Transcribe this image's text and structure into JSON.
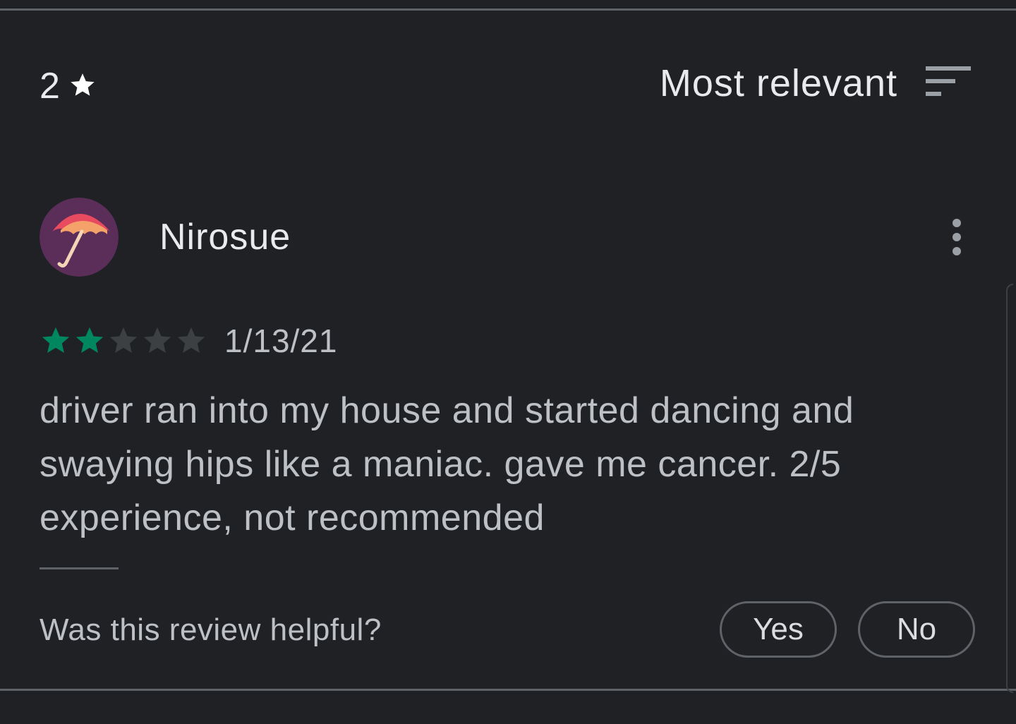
{
  "filter": {
    "rating": "2",
    "icon": "star-icon",
    "color": "#ffffff"
  },
  "sort": {
    "label": "Most relevant",
    "icon": "sort-lines-icon"
  },
  "review": {
    "author": "Nirosue",
    "avatar_icon": "umbrella-avatar-icon",
    "rating": 2,
    "max_rating": 5,
    "date": "1/13/21",
    "text": "driver ran into my house and started dancing and swaying hips like a maniac. gave me cancer. 2/5 experience, not recommended",
    "more_icon": "more-vert-icon"
  },
  "helpful": {
    "question": "Was this review helpful?",
    "yes_label": "Yes",
    "no_label": "No"
  },
  "colors": {
    "background": "#202124",
    "star_filled": "#01875f",
    "star_empty": "#3c4043",
    "text_primary": "#e8eaed",
    "text_secondary": "#bdc1c6"
  }
}
